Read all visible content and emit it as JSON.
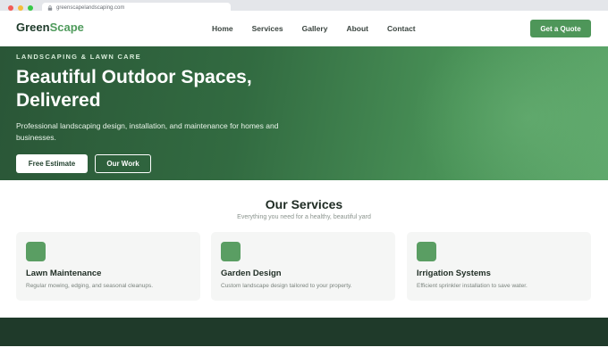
{
  "browser": {
    "url": "greenscapelandscaping.com"
  },
  "nav": {
    "logo_part1": "Green",
    "logo_part2": "Scape",
    "items": [
      {
        "label": "Home"
      },
      {
        "label": "Services"
      },
      {
        "label": "Gallery"
      },
      {
        "label": "About"
      },
      {
        "label": "Contact"
      }
    ],
    "cta_label": "Get a Quote"
  },
  "hero": {
    "eyebrow": "LANDSCAPING & LAWN CARE",
    "headline": "Beautiful Outdoor Spaces, Delivered",
    "subtext": "Professional landscaping design, installation, and maintenance for homes and businesses.",
    "primary_button": "Free Estimate",
    "secondary_button": "Our Work"
  },
  "services": {
    "title": "Our Services",
    "subtitle": "Everything you need for a healthy, beautiful yard",
    "cards": [
      {
        "title": "Lawn Maintenance",
        "description": "Regular mowing, edging, and seasonal cleanups."
      },
      {
        "title": "Garden Design",
        "description": "Custom landscape design tailored to your property."
      },
      {
        "title": "Irrigation Systems",
        "description": "Efficient sprinkler installation to save water."
      }
    ]
  },
  "colors": {
    "brand_green": "#4e9659",
    "dark_green": "#1f3a2a",
    "hero_gradient_start": "#2a5637",
    "hero_gradient_end": "#5ea86b"
  }
}
